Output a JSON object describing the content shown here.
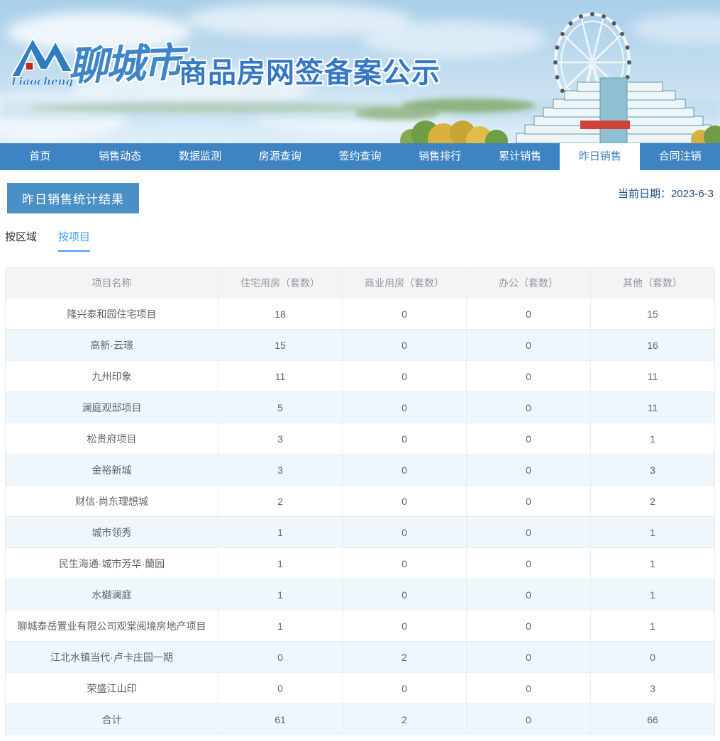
{
  "header": {
    "logo_script_text": "Liaocheng",
    "site_name": "聊城市",
    "site_title": "商品房网签备案公示"
  },
  "nav": {
    "items": [
      {
        "label": "首页",
        "active": false
      },
      {
        "label": "销售动态",
        "active": false
      },
      {
        "label": "数据监测",
        "active": false
      },
      {
        "label": "房源查询",
        "active": false
      },
      {
        "label": "签约查询",
        "active": false
      },
      {
        "label": "销售排行",
        "active": false
      },
      {
        "label": "累计销售",
        "active": false
      },
      {
        "label": "昨日销售",
        "active": true
      },
      {
        "label": "合同注销",
        "active": false
      }
    ]
  },
  "page": {
    "section_title": "昨日销售统计结果",
    "current_date": "当前日期：2023-6-3",
    "tabs": [
      {
        "label": "按区域",
        "active": false
      },
      {
        "label": "按项目",
        "active": true
      }
    ]
  },
  "table": {
    "columns": [
      "项目名称",
      "住宅用房（套数）",
      "商业用房（套数）",
      "办公（套数）",
      "其他（套数）"
    ],
    "rows": [
      {
        "name": "隆兴泰和园住宅项目",
        "values": [
          18,
          0,
          0,
          15
        ]
      },
      {
        "name": "高新·云璟",
        "values": [
          15,
          0,
          0,
          16
        ]
      },
      {
        "name": "九州印象",
        "values": [
          11,
          0,
          0,
          11
        ]
      },
      {
        "name": "澜庭观邸项目",
        "values": [
          5,
          0,
          0,
          11
        ]
      },
      {
        "name": "松贵府项目",
        "values": [
          3,
          0,
          0,
          1
        ]
      },
      {
        "name": "金裕新城",
        "values": [
          3,
          0,
          0,
          3
        ]
      },
      {
        "name": "财信·尚东理想城",
        "values": [
          2,
          0,
          0,
          2
        ]
      },
      {
        "name": "城市领秀",
        "values": [
          1,
          0,
          0,
          1
        ]
      },
      {
        "name": "民生海通·城市芳华·蘭园",
        "values": [
          1,
          0,
          0,
          1
        ]
      },
      {
        "name": "水樾澜庭",
        "values": [
          1,
          0,
          0,
          1
        ]
      },
      {
        "name": "聊城泰岳置业有限公司观棠阅境房地产项目",
        "values": [
          1,
          0,
          0,
          1
        ]
      },
      {
        "name": "江北水镇当代·卢卡庄园一期",
        "values": [
          0,
          2,
          0,
          0
        ]
      },
      {
        "name": "荣盛江山印",
        "values": [
          0,
          0,
          0,
          3
        ]
      },
      {
        "name": "合计",
        "values": [
          61,
          2,
          0,
          66
        ]
      }
    ]
  },
  "colors": {
    "nav_blue": "#3e84c2",
    "section_banner_blue": "#4a90c5",
    "active_tab_blue": "#409eff",
    "date_text_blue": "#234e87",
    "zebra_row_blue": "#eff7fd",
    "table_border": "#e9eef3",
    "table_header_bg": "#f4f4f5",
    "table_header_text": "#8f959e",
    "cell_text": "#5f6368",
    "logo_blue": "#2f7cc0",
    "logo_red": "#c42b1f",
    "site_title_blue": "#3478c5"
  }
}
